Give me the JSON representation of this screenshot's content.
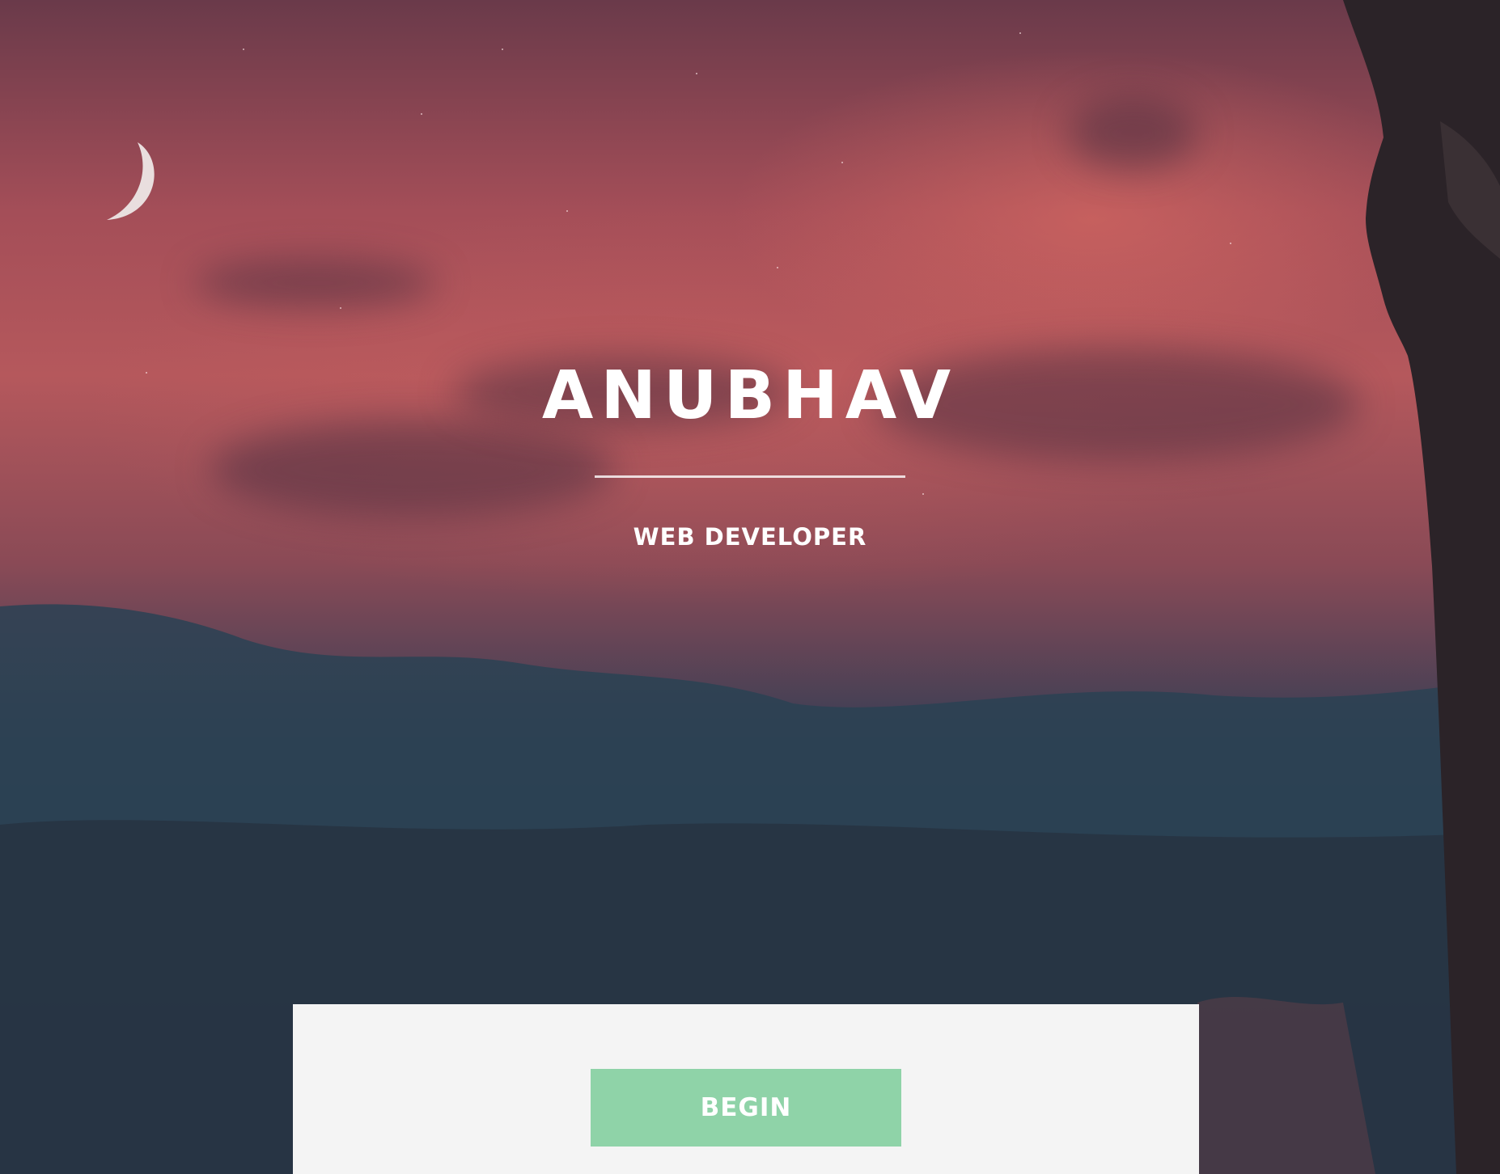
{
  "hero": {
    "title": "ANUBHAV",
    "subtitle": "WEB DEVELOPER"
  },
  "cta": {
    "begin_label": "BEGIN"
  },
  "icons": {
    "moon": "crescent-moon-icon"
  },
  "colors": {
    "button": "#8fd3a8",
    "panel": "#f4f4f4",
    "text": "#ffffff"
  }
}
